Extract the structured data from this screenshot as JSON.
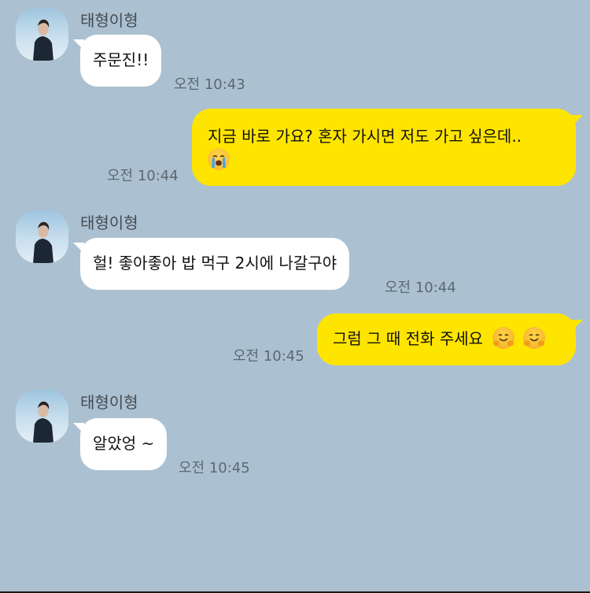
{
  "colors": {
    "background": "#abc1d1",
    "received_bubble": "#ffffff",
    "sent_bubble": "#fee500",
    "time_text": "#5c6870",
    "name_text": "#444c54"
  },
  "messages": [
    {
      "direction": "received",
      "sender": "태형이형",
      "text": "주문진!!",
      "time": "오전 10:43"
    },
    {
      "direction": "sent",
      "line1": "지금 바로 가요? 혼자 가시면 저도 가고 싶은데..",
      "emoji": "loudly-crying-face",
      "time": "오전 10:44"
    },
    {
      "direction": "received",
      "sender": "태형이형",
      "text": "헐! 좋아좋아 밥 먹구 2시에 나갈구야",
      "time": "오전 10:44"
    },
    {
      "direction": "sent",
      "text": "그럼 그 때 전화 주세요",
      "emoji": [
        "hugging-face",
        "hugging-face"
      ],
      "time": "오전 10:45"
    },
    {
      "direction": "received",
      "sender": "태형이형",
      "text": "알았엉 ~",
      "time": "오전 10:45"
    }
  ]
}
